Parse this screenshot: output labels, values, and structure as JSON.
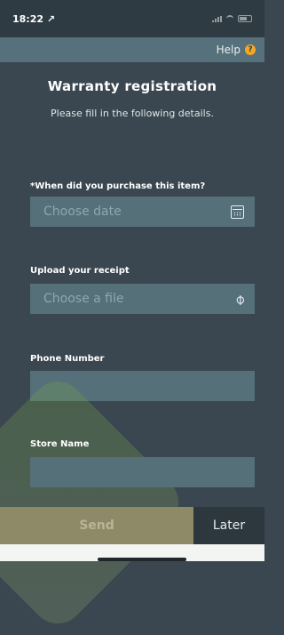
{
  "status_bar": {
    "time": "18:22",
    "location_glyph": "↗"
  },
  "help": {
    "label": "Help",
    "icon": "?"
  },
  "header": {
    "title": "Warranty registration",
    "subtitle": "Please fill in the following details."
  },
  "form": {
    "purchase_date": {
      "label": "*When did you purchase this item?",
      "placeholder": "Choose date",
      "icon": "calendar-icon"
    },
    "receipt": {
      "label": "Upload your receipt",
      "placeholder": "Choose a file",
      "icon": "paperclip-icon"
    },
    "phone": {
      "label": "Phone Number",
      "value": ""
    },
    "store": {
      "label": "Store Name",
      "value": ""
    }
  },
  "actions": {
    "send_label": "Send",
    "later_label": "Later"
  },
  "colors": {
    "background": "#3a4750",
    "field": "#557079",
    "help_accent": "#f5a623",
    "send": "#8e8966",
    "later": "#2c373e"
  }
}
